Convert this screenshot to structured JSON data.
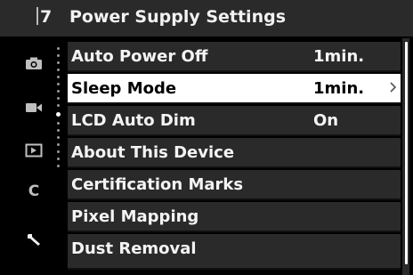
{
  "header": {
    "page_number": "7",
    "title": "Power Supply Settings"
  },
  "sidebar": {
    "icons": [
      "camera-icon",
      "video-camera-icon",
      "playback-icon",
      "custom-c-icon",
      "wrench-icon"
    ],
    "custom_letter": "C"
  },
  "menu": {
    "items": [
      {
        "label": "Auto Power Off",
        "value": "1min."
      },
      {
        "label": "Sleep Mode",
        "value": "1min."
      },
      {
        "label": "LCD Auto Dim",
        "value": "On"
      },
      {
        "label": "About This Device",
        "value": ""
      },
      {
        "label": "Certification Marks",
        "value": ""
      },
      {
        "label": "Pixel Mapping",
        "value": ""
      },
      {
        "label": "Dust Removal",
        "value": ""
      }
    ],
    "selected_index": 1
  },
  "colors": {
    "background": "#000000",
    "row": "#2a2a2a",
    "selected_row": "#ffffff",
    "text": "#f4f4f4"
  }
}
